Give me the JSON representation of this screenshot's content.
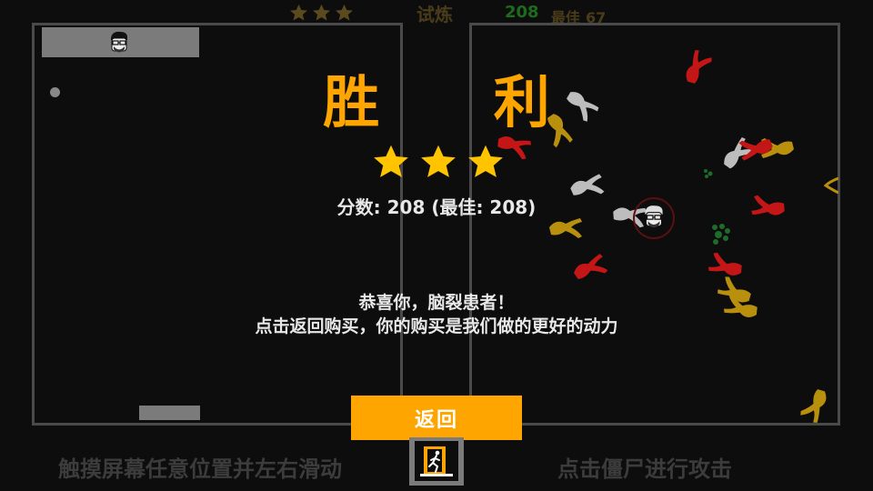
{
  "hud": {
    "stars_earned": 3,
    "stars_total": 3,
    "star_color": "#5a4b1e",
    "mode_label": "试炼",
    "current_score": "208",
    "best_label": "最佳",
    "best_value": "67"
  },
  "victory": {
    "title": "胜 利",
    "stars_earned": 3,
    "star_color": "#ffc400",
    "score_text": "分数: 208 (最佳: 208)",
    "message_line1": "恭喜你，脑裂患者！",
    "message_line2": "点击返回购买，你的购买是我们做的更好的动力",
    "back_label": "返回",
    "accent_color": "#ffa500"
  },
  "hints": {
    "left": "触摸屏幕任意位置并左右滑动",
    "right": "点击僵尸进行攻击"
  },
  "icons": {
    "player_face": "bearded-face-glasses-icon",
    "exit": "running-man-exit-icon",
    "zombie": "crawling-zombie-icon"
  }
}
